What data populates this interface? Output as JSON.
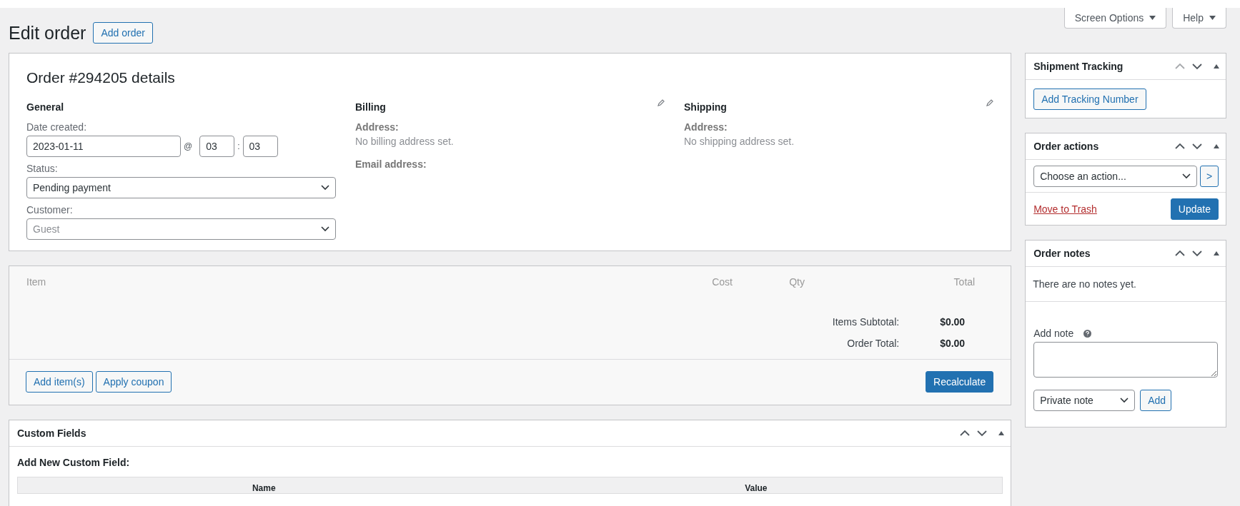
{
  "screen_meta": {
    "buttons": [
      {
        "label": "Screen Options"
      },
      {
        "label": "Help"
      }
    ]
  },
  "page": {
    "title": "Edit order",
    "action": "Add order"
  },
  "order_details": {
    "title": "Order #294205 details",
    "general": {
      "heading": "General",
      "date_label": "Date created:",
      "date": "2023-01-11",
      "at": "@",
      "hour": "03",
      "colon": ":",
      "minute": "03",
      "status_label": "Status:",
      "status": "Pending payment",
      "customer_label": "Customer:",
      "customer_placeholder": "Guest"
    },
    "billing": {
      "heading": "Billing",
      "address_label": "Address:",
      "address": "No billing address set.",
      "email_label": "Email address:"
    },
    "shipping": {
      "heading": "Shipping",
      "address_label": "Address:",
      "address": "No shipping address set."
    }
  },
  "items": {
    "columns": [
      "Item",
      "Cost",
      "Qty",
      "Total"
    ],
    "totals": [
      {
        "label": "Items Subtotal:",
        "value": "$0.00"
      },
      {
        "label": "Order Total:",
        "value": "$0.00"
      }
    ],
    "buttons": [
      "Add item(s)",
      "Apply coupon"
    ],
    "primary_button": "Recalculate"
  },
  "custom_fields": {
    "title": "Custom Fields",
    "can_move_up": true,
    "subtitle": "Add New Custom Field:",
    "columns": [
      "Name",
      "Value"
    ]
  },
  "sidebar": {
    "shipment_tracking": {
      "title": "Shipment Tracking",
      "can_move_up": false,
      "button": "Add Tracking Number"
    },
    "order_actions": {
      "title": "Order actions",
      "can_move_up": true,
      "select": "Choose an action...",
      "go": ">",
      "trash": "Move to Trash",
      "update": "Update"
    },
    "order_notes": {
      "title": "Order notes",
      "can_move_up": true,
      "empty": "There are no notes yet.",
      "add_label": "Add note",
      "note_type": "Private note",
      "add": "Add"
    }
  }
}
